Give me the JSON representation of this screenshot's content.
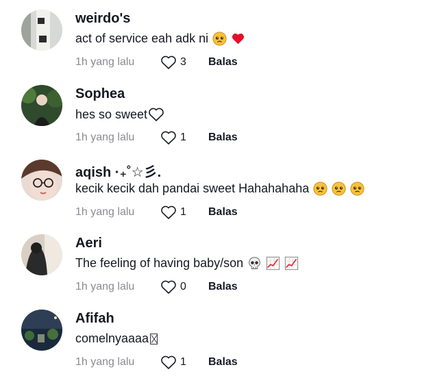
{
  "comments": [
    {
      "username": "weirdo's",
      "text": "act of service eah adk ni",
      "time": "1h yang lalu",
      "likes": "3",
      "reply": "Balas",
      "emojis": [
        "pleading-face-icon",
        "red-heart-icon"
      ]
    },
    {
      "username": "Sophea",
      "text": "hes so sweet",
      "time": "1h yang lalu",
      "likes": "1",
      "reply": "Balas",
      "emojis": [
        "white-heart-icon"
      ]
    },
    {
      "username": "aqish ·₊˚☆彡.",
      "text": "kecik kecik dah pandai sweet Hahahahaha",
      "time": "1h yang lalu",
      "likes": "1",
      "reply": "Balas",
      "emojis": [
        "pleading-face-icon",
        "pleading-face-icon",
        "pleading-face-icon"
      ]
    },
    {
      "username": "Aeri",
      "text": "The feeling of having baby/son",
      "time": "1h yang lalu",
      "likes": "0",
      "reply": "Balas",
      "emojis": [
        "skull-icon",
        "chart-increasing-icon",
        "chart-increasing-icon"
      ]
    },
    {
      "username": "Afifah",
      "text": "comelnyaaaa",
      "time": "1h yang lalu",
      "likes": "1",
      "reply": "Balas",
      "emojis": [
        "missing-glyph-icon"
      ]
    }
  ],
  "colors": {
    "text": "#161823",
    "muted": "#8a8b91",
    "heart_red": "#fe2c55"
  }
}
